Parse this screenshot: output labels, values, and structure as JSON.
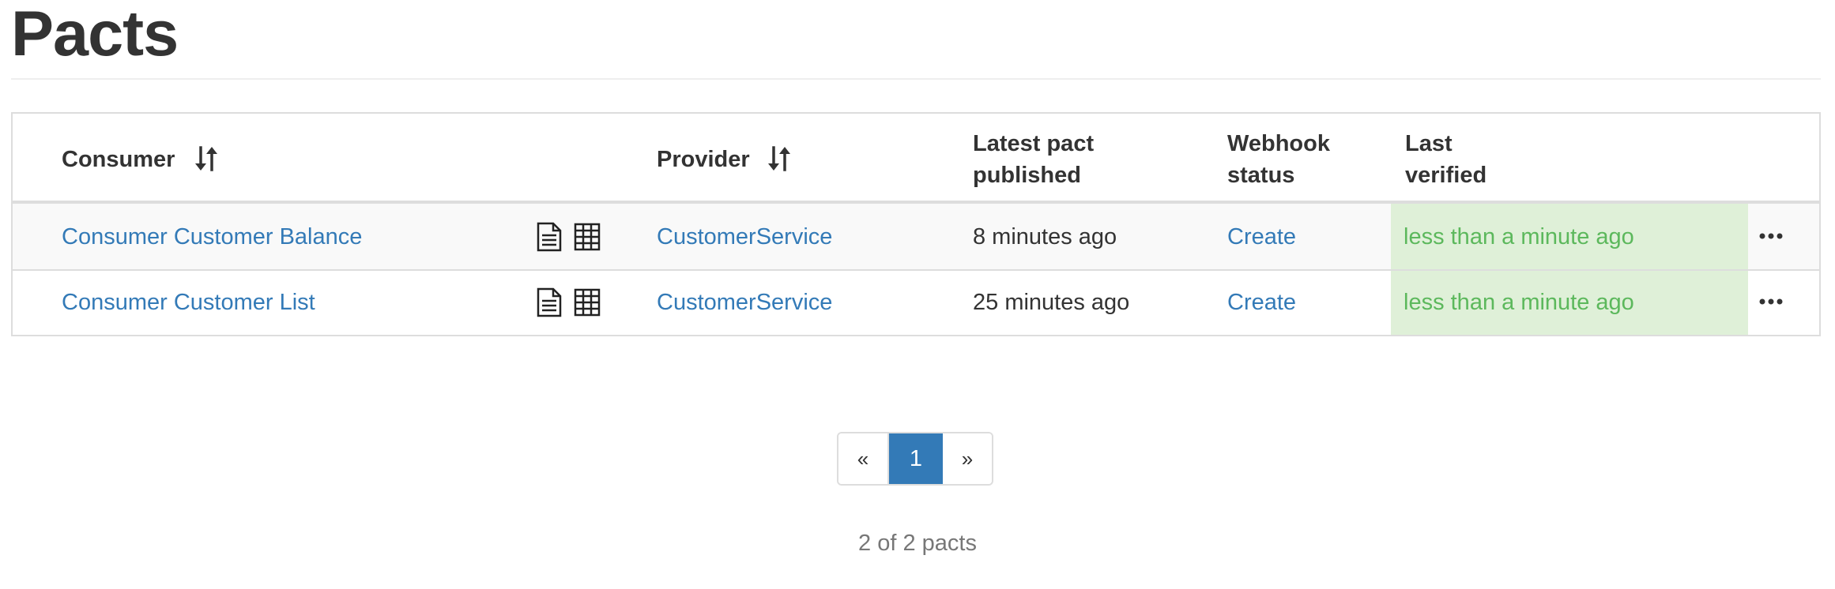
{
  "page": {
    "title": "Pacts"
  },
  "table": {
    "headers": {
      "consumer": "Consumer",
      "provider": "Provider",
      "latest_pact_line1": "Latest pact",
      "latest_pact_line2": "published",
      "webhook_line1": "Webhook",
      "webhook_line2": "status",
      "last_verified_line1": "Last",
      "last_verified_line2": "verified"
    },
    "rows": [
      {
        "consumer": "Consumer Customer Balance",
        "provider": "CustomerService",
        "latest_pact_published": "8 minutes ago",
        "webhook_status": "Create",
        "last_verified": "less than a minute ago"
      },
      {
        "consumer": "Consumer Customer List",
        "provider": "CustomerService",
        "latest_pact_published": "25 minutes ago",
        "webhook_status": "Create",
        "last_verified": "less than a minute ago"
      }
    ],
    "icons": {
      "sort": "sort-icon",
      "document": "document-icon",
      "matrix": "matrix-icon",
      "more": "more-options-icon"
    }
  },
  "pagination": {
    "prev": "«",
    "current": "1",
    "next": "»"
  },
  "summary": "2 of 2 pacts",
  "colors": {
    "link": "#337ab7",
    "verified_bg": "#dff0d8",
    "verified_text": "#5cb85c",
    "active_page": "#337ab7"
  }
}
